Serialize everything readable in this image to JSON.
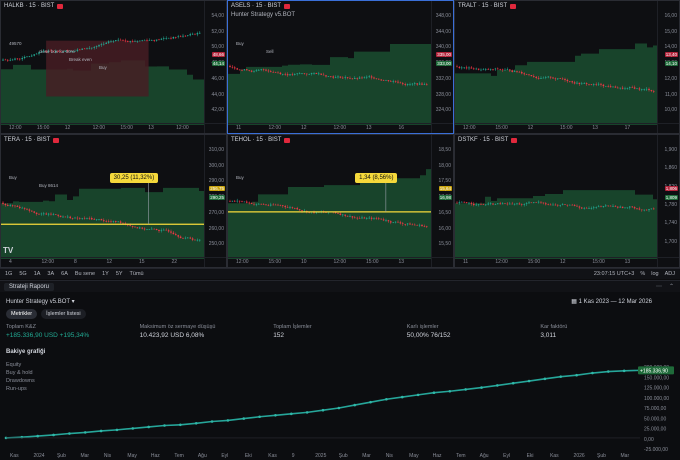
{
  "panels": [
    {
      "symbol": "HALKB · 15 · BIST",
      "yticks": [
        "54,00",
        "52,00",
        "50,00",
        "48,00",
        "46,00",
        "44,00",
        "42,00"
      ],
      "xticks": [
        "12:00",
        "15:00",
        "12",
        "12:00",
        "15:00",
        "13",
        "12:00"
      ],
      "price_tag": "44,14",
      "alt_tag": "48,66",
      "notes": [
        "49570",
        "close box for 50%",
        "Break even",
        "Buy"
      ]
    },
    {
      "symbol": "ASELS · 15 · BIST",
      "yticks": [
        "348,00",
        "344,00",
        "340,00",
        "336,00",
        "332,00",
        "328,00",
        "324,00"
      ],
      "xticks": [
        "11",
        "12:00",
        "12",
        "12:00",
        "13",
        "16"
      ],
      "price_tag": "333,00",
      "alt_tag": "335,00",
      "strategy": "Hunter Strategy v5.BOT",
      "notes": [
        "Buy",
        "Sell"
      ]
    },
    {
      "symbol": "TRALT · 15 · BIST",
      "yticks": [
        "16,00",
        "15,00",
        "14,00",
        "13,00",
        "12,00",
        "11,00",
        "10,00"
      ],
      "xticks": [
        "12:00",
        "15:00",
        "12",
        "15:00",
        "13",
        "17"
      ],
      "price_tag": "14,10",
      "alt_tag": "13,40"
    },
    {
      "symbol": "TERA · 15 · BIST",
      "yticks": [
        "310,00",
        "300,00",
        "290,00",
        "280,00",
        "270,00",
        "260,00",
        "250,00"
      ],
      "xticks": [
        "4",
        "12:00",
        "8",
        "12",
        "15",
        "22"
      ],
      "price_tag": "290,25",
      "alt_tag": "256,75",
      "callout": "30,25 (11,32%)",
      "notes": [
        "Buy",
        "Buy 8614"
      ]
    },
    {
      "symbol": "TEHOL · 15 · BIST",
      "yticks": [
        "18,50",
        "18,00",
        "17,50",
        "17,00",
        "16,50",
        "16,00",
        "15,50"
      ],
      "xticks": [
        "12:00",
        "15:00",
        "10",
        "12:00",
        "15:00",
        "13"
      ],
      "price_tag": "16,98",
      "alt_tag": "15,64",
      "callout": "1,34 (8,56%)",
      "notes": [
        "Buy"
      ]
    },
    {
      "symbol": "DSTKF · 15 · BIST",
      "yticks": [
        "1,900",
        "1,860",
        "1,820",
        "1,780",
        "1,740",
        "1,700"
      ],
      "xticks": [
        "11",
        "12:00",
        "15:00",
        "12",
        "15:00",
        "13"
      ],
      "price_tag": "1,809",
      "alt_tag": "1,806"
    }
  ],
  "toolbar": {
    "ranges": [
      "1G",
      "5G",
      "1A",
      "3A",
      "6A",
      "Bu sene",
      "1Y",
      "5Y",
      "Tümü"
    ],
    "clock": "23:07:15 UTC+3",
    "mode": "%",
    "log": "log",
    "auto": "ADJ"
  },
  "tabbar": {
    "tab": "Strateji Raporu"
  },
  "report": {
    "strategy": "Hunter Strategy v5.BOT",
    "daterange": "1 Kas 2023 — 12 Mar 2026",
    "btn_metrics": "Metrikler",
    "btn_trades": "İşlemler listesi",
    "metrics": [
      {
        "label": "Toplam K&Z",
        "value": "+185.336,90",
        "sub": "+195,34%",
        "unit": "USD"
      },
      {
        "label": "Maksimum öz sermaye düşüşü",
        "value": "10.423,92",
        "sub": "6,08%",
        "unit": "USD"
      },
      {
        "label": "Toplam İşlemler",
        "value": "152",
        "sub": "",
        "unit": ""
      },
      {
        "label": "Karlı işlemler",
        "value": "50,00%",
        "sub": "76/152",
        "unit": ""
      },
      {
        "label": "Kar faktörü",
        "value": "3,011",
        "sub": "",
        "unit": ""
      }
    ],
    "section": "Bakiye grafiği",
    "legend": [
      "Equity",
      "Buy & hold",
      "Drawdowns",
      "Run-ups"
    ],
    "eq_yticks": [
      "200.000,00",
      "150.000,00",
      "125.000,00",
      "100.000,00",
      "75.000,00",
      "50.000,00",
      "25.000,00",
      "0,00",
      "-25.000,00"
    ],
    "eq_xticks": [
      "Kas",
      "2024",
      "Şub",
      "Mar",
      "Nis",
      "May",
      "Haz",
      "Tem",
      "Ağu",
      "Eyl",
      "Eki",
      "Kas",
      "9",
      "2025",
      "Şub",
      "Mar",
      "Nis",
      "May",
      "Haz",
      "Tem",
      "Ağu",
      "Eyl",
      "Eki",
      "Kas",
      "2026",
      "Şub",
      "Mar"
    ],
    "eq_tag": "+185.336,90"
  },
  "chart_data": {
    "type": "line",
    "title": "Bakiye grafiği",
    "xlabel": "",
    "ylabel": "",
    "ylim": [
      -25000,
      200000
    ],
    "series": [
      {
        "name": "Equity",
        "values": [
          0,
          2000,
          5000,
          8000,
          12000,
          15000,
          19000,
          22000,
          26000,
          30000,
          34000,
          36000,
          40000,
          45000,
          48000,
          53000,
          58000,
          62000,
          66000,
          70000,
          76000,
          82000,
          90000,
          98000,
          106000,
          112000,
          118000,
          124000,
          128000,
          133000,
          138000,
          144000,
          150000,
          156000,
          162000,
          168000,
          172000,
          178000,
          182000,
          184000,
          185336
        ]
      }
    ]
  },
  "colors": {
    "up": "#22ab94",
    "down": "#f23645",
    "equity": "#26a69a",
    "band": "#1f6b3a"
  }
}
